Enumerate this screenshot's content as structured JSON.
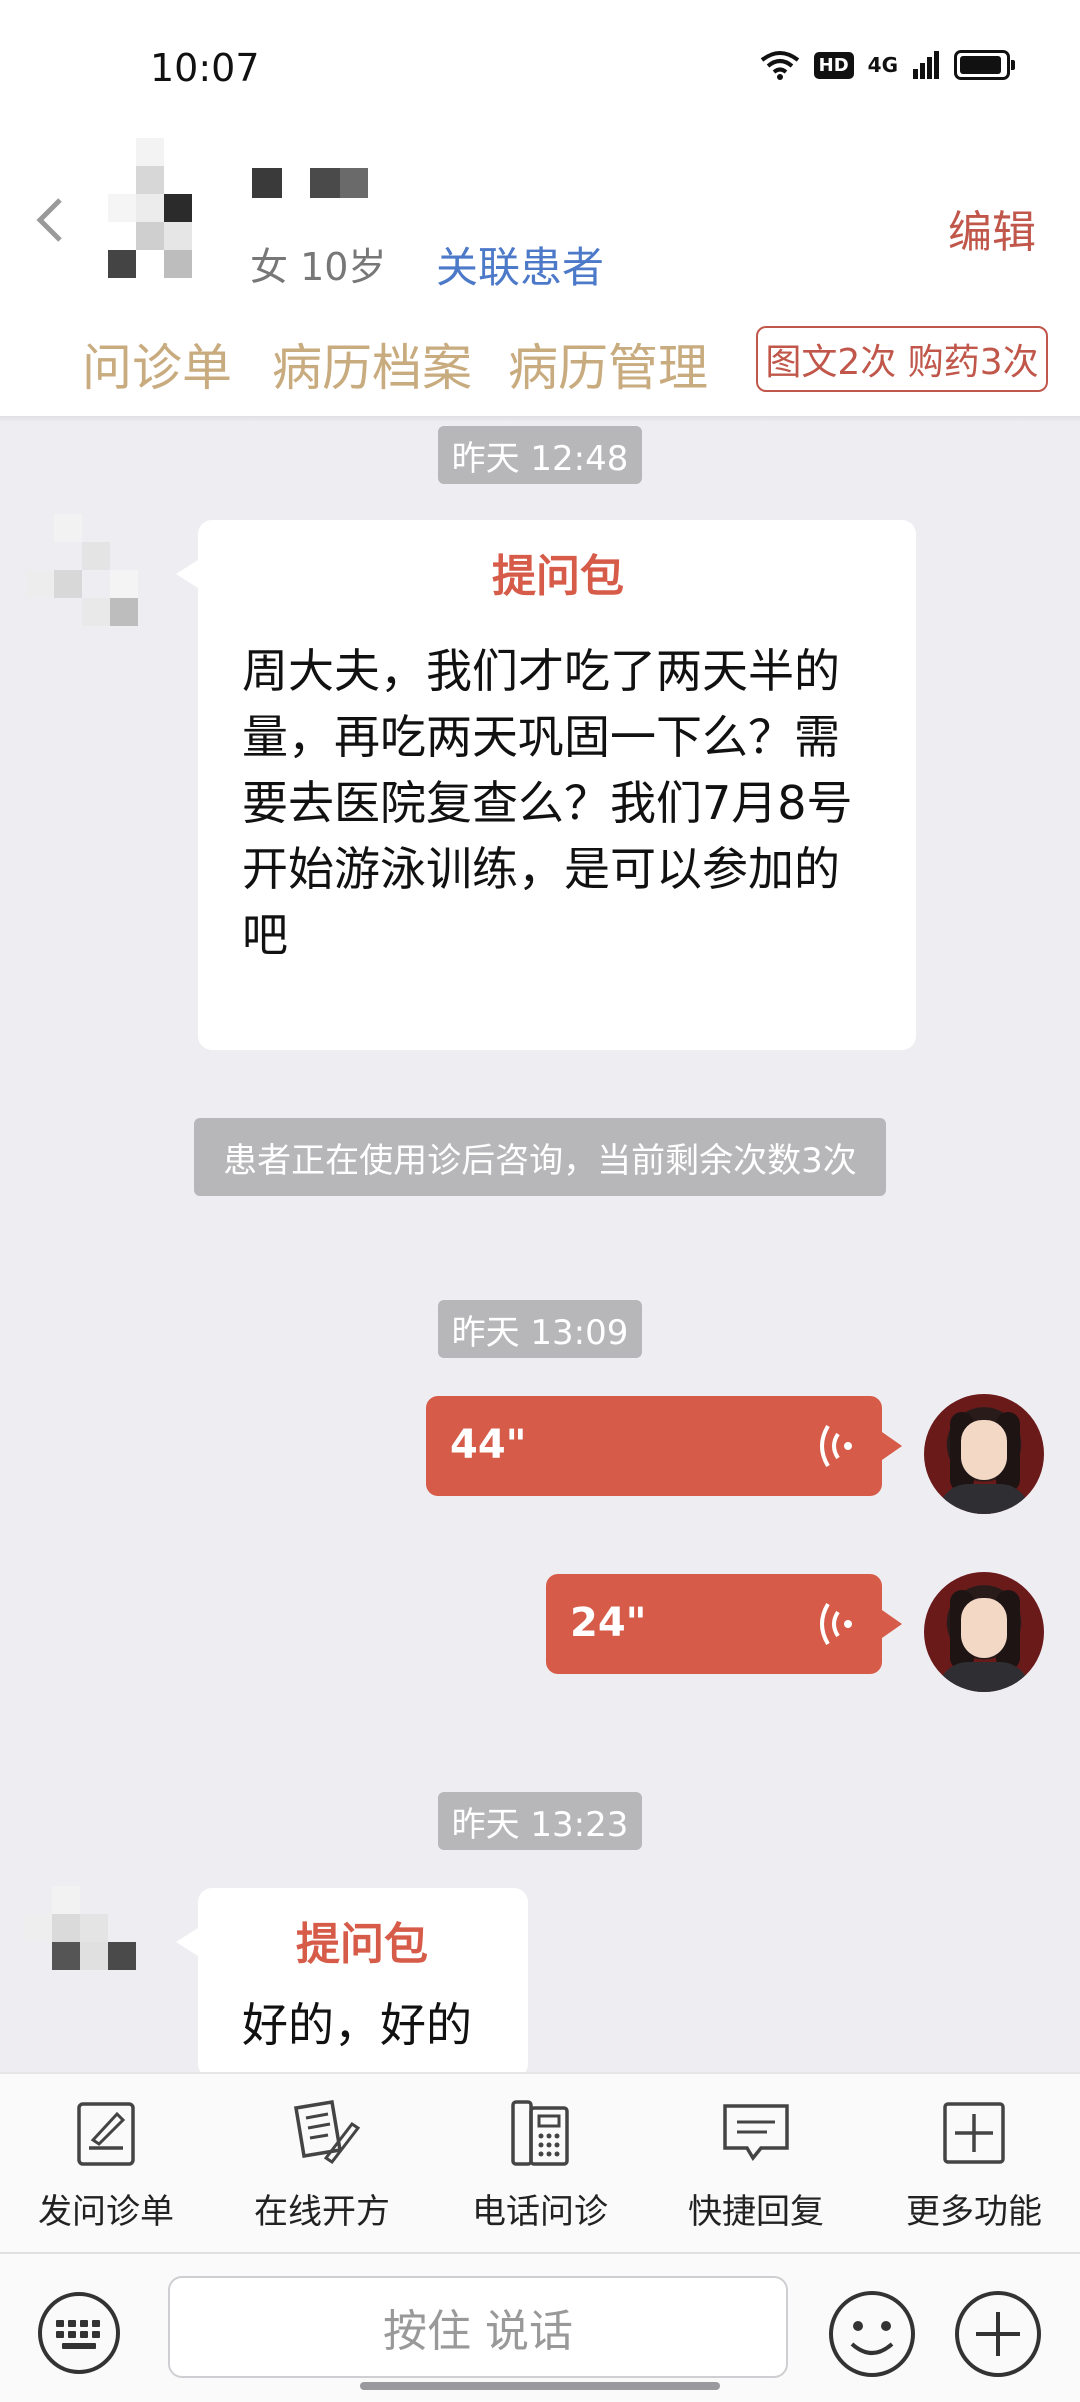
{
  "status_bar": {
    "time": "10:07",
    "hd": "HD",
    "network": "4G"
  },
  "header": {
    "patient_meta": "女 10岁",
    "link_patient": "关联患者",
    "edit": "编辑",
    "tabs": [
      "问诊单",
      "病历档案",
      "病历管理"
    ],
    "quota": "图文2次 购药3次"
  },
  "messages": {
    "t1": "昨天 12:48",
    "m1_title": "提问包",
    "m1_text": "周大夫，我们才吃了两天半的量，再吃两天巩固一下么？需要去医院复查么？我们7月8号开始游泳训练，是可以参加的吧",
    "notice": "患者正在使用诊后咨询，当前剩余次数3次",
    "t2": "昨天 13:09",
    "voice1": "44\"",
    "voice2": "24\"",
    "t3": "昨天 13:23",
    "m2_title": "提问包",
    "m2_text": "好的，好的"
  },
  "toolbar": [
    "发问诊单",
    "在线开方",
    "电话问诊",
    "快捷回复",
    "更多功能"
  ],
  "input": {
    "hold_to_talk": "按住 说话"
  },
  "colors": {
    "accent": "#d65b48",
    "tab_gold": "#c8ab7e",
    "link_blue": "#4d79c9",
    "chat_bg": "#eeeef2"
  }
}
